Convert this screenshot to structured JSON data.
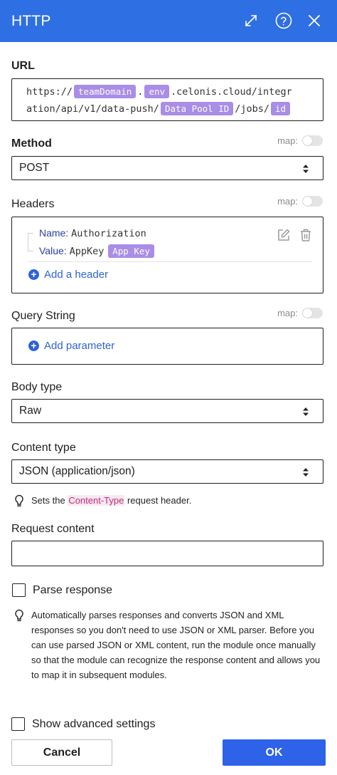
{
  "header": {
    "title": "HTTP"
  },
  "url": {
    "label": "URL",
    "part1": "https://",
    "var_team": "teamDomain",
    "dot": ".",
    "var_env": "env",
    "part2": ".celonis.cloud/integr",
    "part3": "ation/api/v1/data-push/",
    "var_pool": "Data Pool ID",
    "part4": "/jobs/",
    "var_id": "id"
  },
  "method": {
    "label": "Method",
    "map_label": "map:",
    "value": "POST"
  },
  "headers": {
    "label": "Headers",
    "map_label": "map:",
    "items": [
      {
        "name_key": "Name:",
        "name_value": "Authorization",
        "value_key": "Value:",
        "value_text": "AppKey",
        "value_pill": "App Key"
      }
    ],
    "add_label": "Add a header"
  },
  "query": {
    "label": "Query String",
    "map_label": "map:",
    "add_label": "Add parameter"
  },
  "body_type": {
    "label": "Body type",
    "value": "Raw"
  },
  "content_type": {
    "label": "Content type",
    "value": "JSON (application/json)",
    "hint_pre": "Sets the ",
    "hint_highlight": "Content-Type",
    "hint_post": " request header."
  },
  "request_content": {
    "label": "Request content",
    "value": ""
  },
  "parse_response": {
    "label": "Parse response",
    "checked": false,
    "hint": "Automatically parses responses and converts JSON and XML responses so you don't need to use JSON or XML parser. Before you can use parsed JSON or XML content, run the module once manually so that the module can recognize the response content and allows you to map it in subsequent modules."
  },
  "advanced": {
    "label": "Show advanced settings",
    "checked": false
  },
  "footer": {
    "cancel_label": "Cancel",
    "ok_label": "OK"
  },
  "colors": {
    "header_bg": "#2f6fe4",
    "pill_bg": "#a98de6",
    "link": "#2e62d6",
    "ok_bg": "#2e62e8",
    "highlight": "#c62c7e"
  }
}
